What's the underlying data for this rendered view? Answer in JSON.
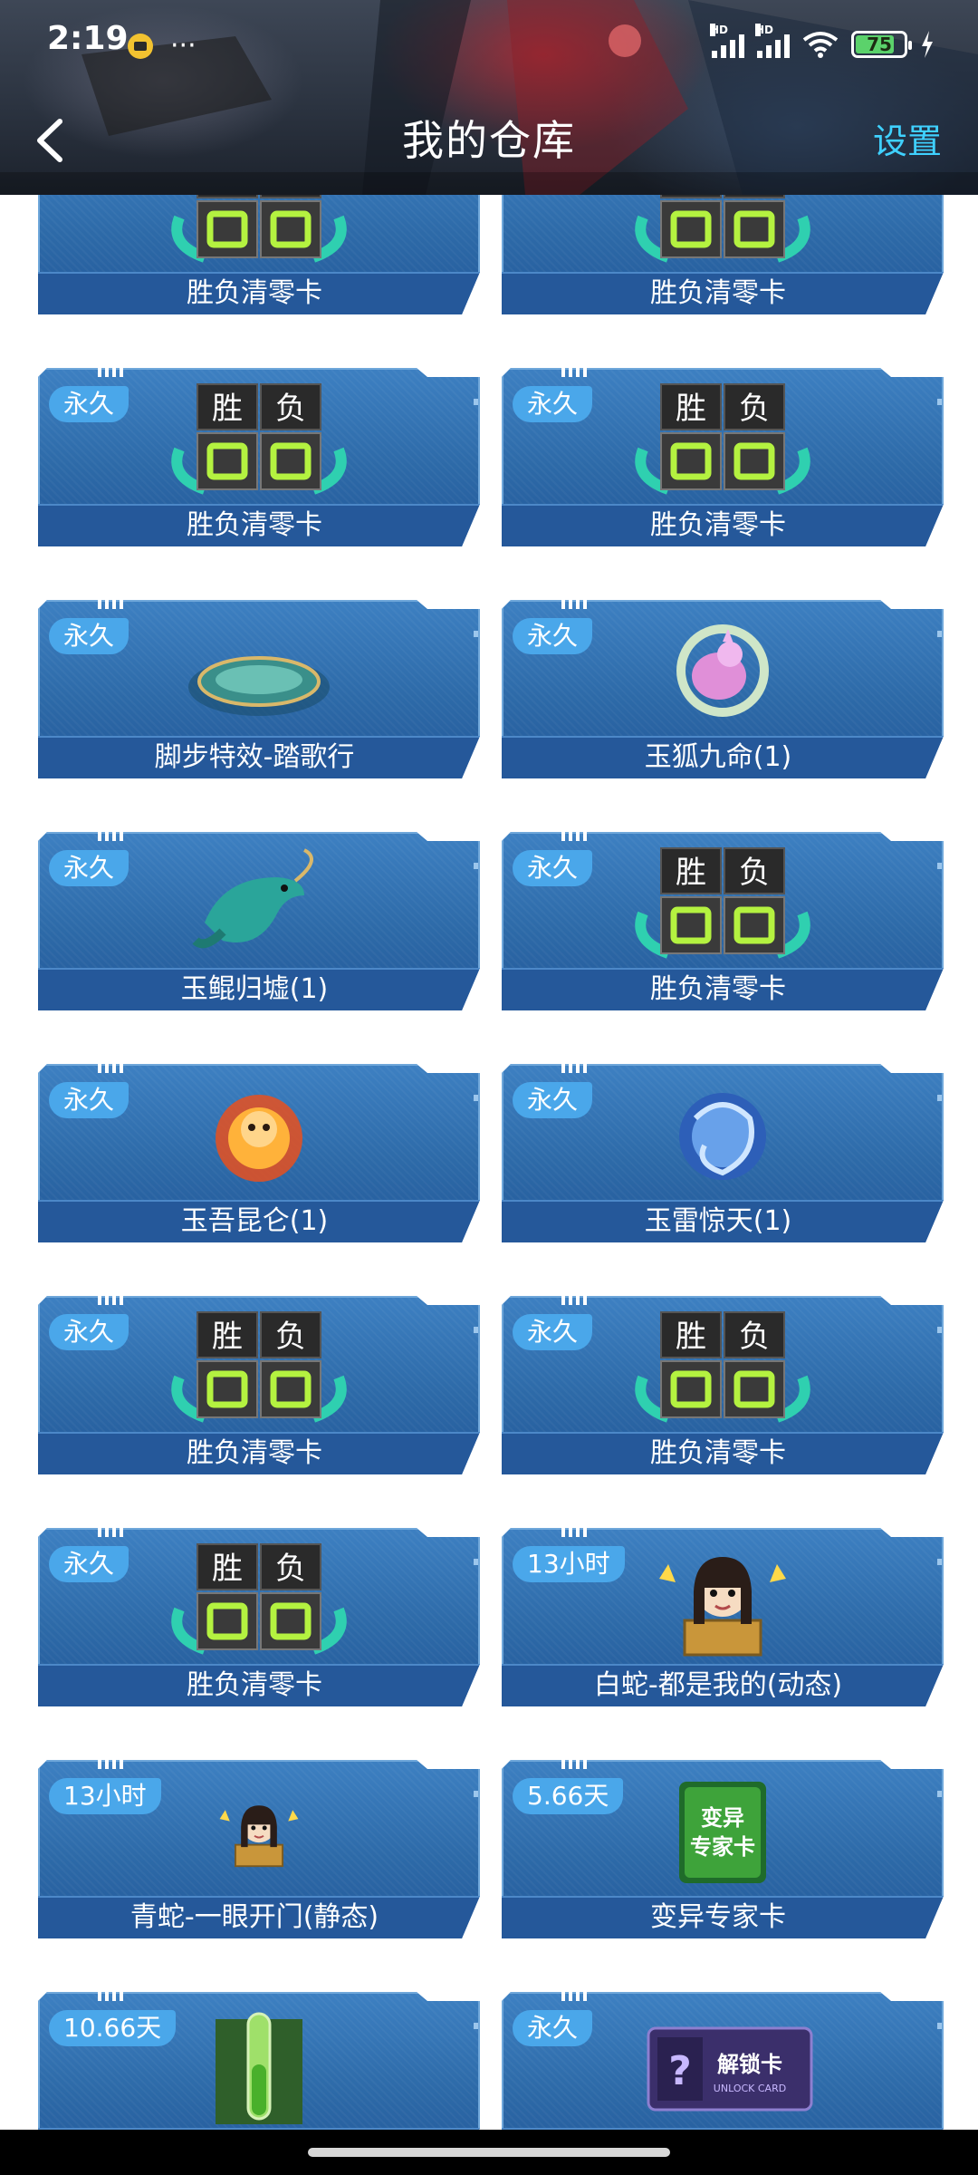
{
  "status_bar": {
    "time": "2:19",
    "dots": "···",
    "signal_labels": [
      "HD",
      "HD"
    ],
    "battery": "75"
  },
  "header": {
    "title": "我的仓库",
    "settings_label": "设置"
  },
  "item_art_text": {
    "win": "胜",
    "lose": "负",
    "expert_card_line1": "变异",
    "expert_card_line2": "专家卡",
    "unlock_card": "解锁卡",
    "unlock_card_sub": "UNLOCK CARD",
    "question": "?"
  },
  "items": [
    {
      "name": "胜负清零卡",
      "badge": "",
      "art": "winlose"
    },
    {
      "name": "胜负清零卡",
      "badge": "",
      "art": "winlose"
    },
    {
      "name": "胜负清零卡",
      "badge": "永久",
      "art": "winlose"
    },
    {
      "name": "胜负清零卡",
      "badge": "永久",
      "art": "winlose"
    },
    {
      "name": "脚步特效-踏歌行",
      "badge": "永久",
      "art": "ring"
    },
    {
      "name": "玉狐九命(1)",
      "badge": "永久",
      "art": "fox"
    },
    {
      "name": "玉鲲归墟(1)",
      "badge": "永久",
      "art": "fish"
    },
    {
      "name": "胜负清零卡",
      "badge": "永久",
      "art": "winlose"
    },
    {
      "name": "玉吾昆仑(1)",
      "badge": "永久",
      "art": "fire"
    },
    {
      "name": "玉雷惊天(1)",
      "badge": "永久",
      "art": "thunder"
    },
    {
      "name": "胜负清零卡",
      "badge": "永久",
      "art": "winlose"
    },
    {
      "name": "胜负清零卡",
      "badge": "永久",
      "art": "winlose"
    },
    {
      "name": "胜负清零卡",
      "badge": "永久",
      "art": "winlose"
    },
    {
      "name": "白蛇-都是我的(动态)",
      "badge": "13小时",
      "art": "girl"
    },
    {
      "name": "青蛇-一眼开门(静态)",
      "badge": "13小时",
      "art": "girl_small"
    },
    {
      "name": "变异专家卡",
      "badge": "5.66天",
      "art": "expert"
    },
    {
      "name": "",
      "badge": "10.66天",
      "art": "tube"
    },
    {
      "name": "",
      "badge": "永久",
      "art": "unlock"
    }
  ],
  "colors": {
    "accent": "#3fd1ff",
    "card_blue": "#2d6aa8",
    "badge_blue": "#4aa7ea"
  }
}
